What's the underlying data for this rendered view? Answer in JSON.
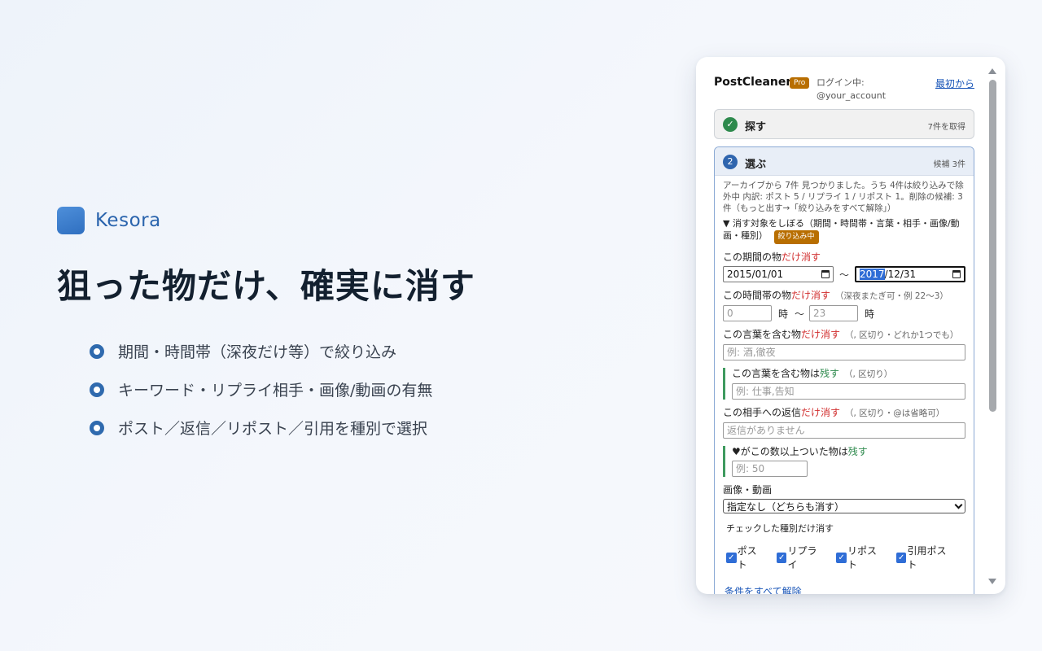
{
  "brand": {
    "name": "Kesora"
  },
  "headline": "狙った物だけ、確実に消す",
  "features": [
    "期間・時間帯（深夜だけ等）で絞り込み",
    "キーワード・リプライ相手・画像/動画の有無",
    "ポスト／返信／リポスト／引用を種別で選択"
  ],
  "panel": {
    "title": "PostCleaner",
    "badge": "Pro",
    "login_label": "ログイン中:",
    "account": "@your_account",
    "reset_link": "最初から",
    "step1": {
      "label": "探す",
      "meta": "7件を取得"
    },
    "step2": {
      "number": "2",
      "label": "選ぶ",
      "meta": "候補 3件",
      "summary": "アーカイブから 7件 見つかりました。うち 4件は絞り込みで除外中 内訳: ポスト 5 / リプライ 1 / リポスト 1。削除の候補: 3件（もっと出す→「絞り込みをすべて解除」）",
      "filter_toggle": "▼ 消す対象をしぼる（期間・時間帯・言葉・相手・画像/動画・種別）",
      "filter_badge": "絞り込み中",
      "period": {
        "label": "この期間の物",
        "emph": "だけ消す",
        "from": "2015/01/01",
        "to_sel": "2017",
        "to_rest": "/12/31",
        "sep": "〜"
      },
      "time": {
        "label": "この時間帯の物",
        "emph": "だけ消す",
        "hint": "（深夜またぎ可・例 22〜3）",
        "from_placeholder": "0",
        "to_placeholder": "23",
        "unit": "時",
        "sep": "〜"
      },
      "include_words": {
        "label": "この言葉を含む物",
        "emph": "だけ消す",
        "hint": "（, 区切り・どれか1つでも）",
        "placeholder": "例: 酒,徹夜"
      },
      "keep_words": {
        "label": "この言葉を含む物は",
        "emph": "残す",
        "hint": "（, 区切り）",
        "placeholder": "例: 仕事,告知"
      },
      "reply_to": {
        "label": "この相手への返信",
        "emph": "だけ消す",
        "hint": "（, 区切り・@は省略可）",
        "placeholder": "返信がありません"
      },
      "likes_keep": {
        "label": "♥がこの数以上ついた物は",
        "emph": "残す",
        "placeholder": "例: 50"
      },
      "media": {
        "label": "画像・動画",
        "selected": "指定なし（どちらも消す）"
      },
      "types": {
        "label": "チェックした種別だけ消す",
        "items": [
          "ポスト",
          "リプライ",
          "リポスト",
          "引用ポスト"
        ]
      },
      "clear_link": "条件をすべて解除"
    }
  },
  "colors": {
    "accent": "#2f6aae",
    "danger": "#d12e2e",
    "keep": "#2e8a4d",
    "badge": "#b86e00"
  }
}
